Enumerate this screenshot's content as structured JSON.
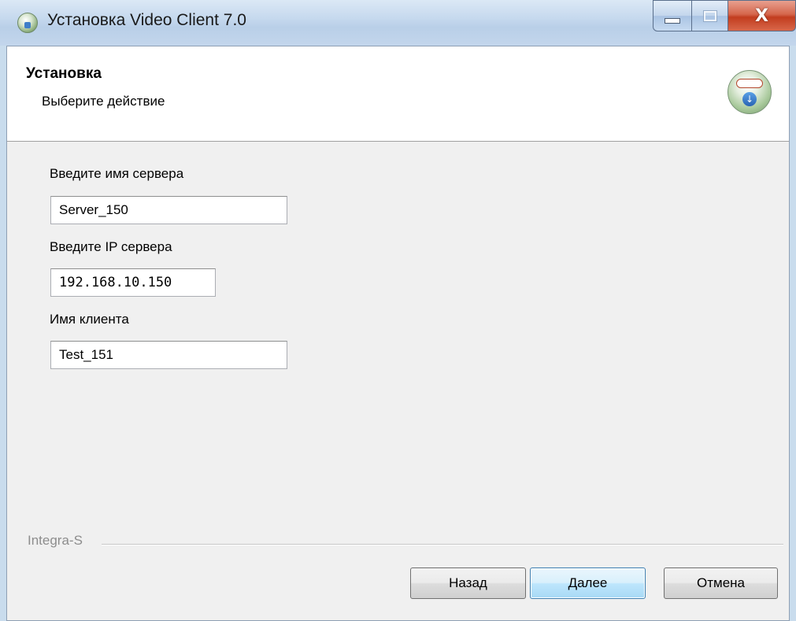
{
  "window": {
    "title": "Установка Video Client 7.0",
    "close_glyph": "X"
  },
  "header": {
    "title": "Установка",
    "subtitle": "Выберите действие",
    "logo_icon": "installer-logo-icon"
  },
  "form": {
    "server_name": {
      "label": "Введите имя сервера",
      "value": "Server_150"
    },
    "server_ip": {
      "label": "Введите IP сервера",
      "value": "192.168.10.150"
    },
    "client_name": {
      "label": "Имя клиента",
      "value": "Test_151"
    }
  },
  "footer": {
    "brand": "Integra-S"
  },
  "buttons": {
    "back": "Назад",
    "next": "Далее",
    "cancel": "Отмена"
  },
  "colors": {
    "close_button": "#c23d1f",
    "default_button_border": "#3c7fb1"
  }
}
